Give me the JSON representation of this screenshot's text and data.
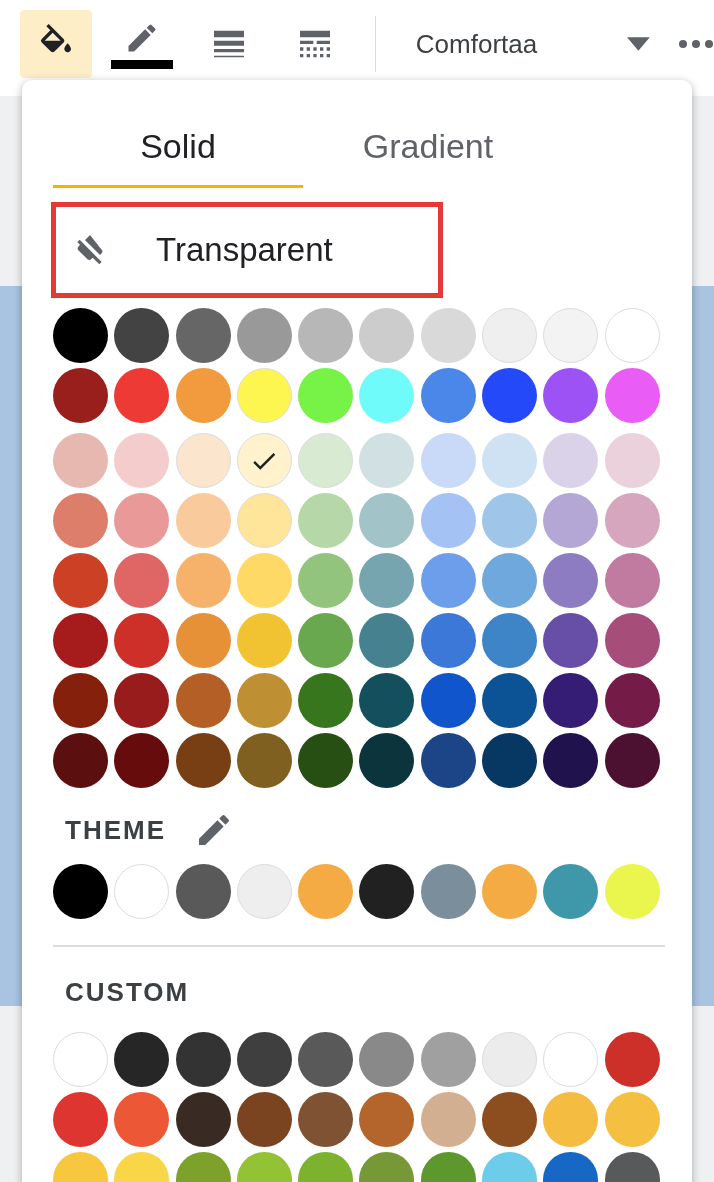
{
  "toolbar": {
    "items": [
      {
        "kind": "fill",
        "selected": true
      },
      {
        "kind": "pencil",
        "selected": false,
        "color": "#000000"
      },
      {
        "kind": "weight",
        "selected": false
      },
      {
        "kind": "dash",
        "selected": false
      }
    ],
    "font": "Comfortaa"
  },
  "popup": {
    "tabs": [
      {
        "label": "Solid",
        "selected": true
      },
      {
        "label": "Gradient",
        "selected": false
      }
    ],
    "transparent": {
      "label": "Transparent"
    },
    "standard": [
      [
        {
          "color": "#000000",
          "selected": false
        },
        {
          "color": "#434343",
          "selected": false
        },
        {
          "color": "#666666",
          "selected": false
        },
        {
          "color": "#999999",
          "selected": false
        },
        {
          "color": "#b7b7b7",
          "selected": false
        },
        {
          "color": "#cccccc",
          "selected": false
        },
        {
          "color": "#d9d9d9",
          "selected": false
        },
        {
          "color": "#efefef",
          "selected": false
        },
        {
          "color": "#f3f3f3",
          "selected": false
        },
        {
          "color": "#ffffff",
          "selected": false
        }
      ],
      [
        {
          "color": "#981f1c",
          "selected": false
        },
        {
          "color": "#ee3a35",
          "selected": false
        },
        {
          "color": "#f29b3e",
          "selected": false
        },
        {
          "color": "#fef650",
          "selected": false
        },
        {
          "color": "#76f346",
          "selected": false
        },
        {
          "color": "#6efbf9",
          "selected": false
        },
        {
          "color": "#4b87e8",
          "selected": false
        },
        {
          "color": "#2449f9",
          "selected": false
        },
        {
          "color": "#9d52f6",
          "selected": false
        },
        {
          "color": "#ea5cf6",
          "selected": false
        }
      ],
      [
        {
          "color": "#e6b8af",
          "selected": false
        },
        {
          "color": "#f4cccc",
          "selected": false
        },
        {
          "color": "#fce5cd",
          "selected": false
        },
        {
          "color": "#fff2cc",
          "selected": true
        },
        {
          "color": "#d9ead3",
          "selected": false
        },
        {
          "color": "#d0e0e3",
          "selected": false
        },
        {
          "color": "#c9daf8",
          "selected": false
        },
        {
          "color": "#cfe2f3",
          "selected": false
        },
        {
          "color": "#d9d2e9",
          "selected": false
        },
        {
          "color": "#ead1dc",
          "selected": false
        }
      ],
      [
        {
          "color": "#dd7e6b",
          "selected": false
        },
        {
          "color": "#ea9999",
          "selected": false
        },
        {
          "color": "#f9cb9c",
          "selected": false
        },
        {
          "color": "#ffe599",
          "selected": false
        },
        {
          "color": "#b6d7a8",
          "selected": false
        },
        {
          "color": "#a2c4c9",
          "selected": false
        },
        {
          "color": "#a4c2f4",
          "selected": false
        },
        {
          "color": "#9fc5e8",
          "selected": false
        },
        {
          "color": "#b4a7d6",
          "selected": false
        },
        {
          "color": "#d5a6bd",
          "selected": false
        }
      ],
      [
        {
          "color": "#cc4125",
          "selected": false
        },
        {
          "color": "#e06666",
          "selected": false
        },
        {
          "color": "#f6b26b",
          "selected": false
        },
        {
          "color": "#ffd966",
          "selected": false
        },
        {
          "color": "#93c47d",
          "selected": false
        },
        {
          "color": "#76a5af",
          "selected": false
        },
        {
          "color": "#6d9eeb",
          "selected": false
        },
        {
          "color": "#6fa8dc",
          "selected": false
        },
        {
          "color": "#8e7cc3",
          "selected": false
        },
        {
          "color": "#c27ba0",
          "selected": false
        }
      ],
      [
        {
          "color": "#a61c1c",
          "selected": false
        },
        {
          "color": "#cc3029",
          "selected": false
        },
        {
          "color": "#e69138",
          "selected": false
        },
        {
          "color": "#f1c232",
          "selected": false
        },
        {
          "color": "#6aa84f",
          "selected": false
        },
        {
          "color": "#45818e",
          "selected": false
        },
        {
          "color": "#3c78d8",
          "selected": false
        },
        {
          "color": "#3d85c6",
          "selected": false
        },
        {
          "color": "#674ea7",
          "selected": false
        },
        {
          "color": "#a64d79",
          "selected": false
        }
      ],
      [
        {
          "color": "#85200c",
          "selected": false
        },
        {
          "color": "#991c1c",
          "selected": false
        },
        {
          "color": "#b45f26",
          "selected": false
        },
        {
          "color": "#bf9033",
          "selected": false
        },
        {
          "color": "#38761d",
          "selected": false
        },
        {
          "color": "#134f5c",
          "selected": false
        },
        {
          "color": "#1155cc",
          "selected": false
        },
        {
          "color": "#0b5394",
          "selected": false
        },
        {
          "color": "#351c75",
          "selected": false
        },
        {
          "color": "#741b47",
          "selected": false
        }
      ],
      [
        {
          "color": "#5b0f0f",
          "selected": false
        },
        {
          "color": "#660c0c",
          "selected": false
        },
        {
          "color": "#783f14",
          "selected": false
        },
        {
          "color": "#7f6020",
          "selected": false
        },
        {
          "color": "#274e13",
          "selected": false
        },
        {
          "color": "#0c343d",
          "selected": false
        },
        {
          "color": "#1c4587",
          "selected": false
        },
        {
          "color": "#073763",
          "selected": false
        },
        {
          "color": "#20124d",
          "selected": false
        },
        {
          "color": "#4c1130",
          "selected": false
        }
      ]
    ],
    "theme": {
      "label": "THEME",
      "swatches": [
        [
          {
            "color": "#000000",
            "selected": false
          },
          {
            "color": "#ffffff",
            "selected": false
          },
          {
            "color": "#595959",
            "selected": false
          },
          {
            "color": "#eeeeee",
            "selected": false
          },
          {
            "color": "#f4ab44",
            "selected": false
          },
          {
            "color": "#212121",
            "selected": false
          },
          {
            "color": "#7a8f9b",
            "selected": false
          },
          {
            "color": "#f4ab44",
            "selected": false
          },
          {
            "color": "#3f98aa",
            "selected": false
          },
          {
            "color": "#eaf54e",
            "selected": false
          }
        ]
      ]
    },
    "custom": {
      "label": "CUSTOM",
      "swatches": [
        [
          {
            "color": "#ffffff",
            "selected": false
          },
          {
            "color": "#262626",
            "selected": false
          },
          {
            "color": "#333333",
            "selected": false
          },
          {
            "color": "#3f3f3f",
            "selected": false
          },
          {
            "color": "#595959",
            "selected": false
          },
          {
            "color": "#898989",
            "selected": false
          },
          {
            "color": "#a0a0a0",
            "selected": false
          },
          {
            "color": "#ececec",
            "selected": false
          },
          {
            "color": "#ffffff",
            "selected": false
          },
          {
            "color": "#cd3029",
            "selected": false
          }
        ],
        [
          {
            "color": "#df3530",
            "selected": false
          },
          {
            "color": "#ec5735",
            "selected": false
          },
          {
            "color": "#3a2a24",
            "selected": false
          },
          {
            "color": "#7a4421",
            "selected": false
          },
          {
            "color": "#7f5233",
            "selected": false
          },
          {
            "color": "#b3652b",
            "selected": false
          },
          {
            "color": "#d3af92",
            "selected": false
          },
          {
            "color": "#8c4d1f",
            "selected": false
          },
          {
            "color": "#f5bc42",
            "selected": false
          },
          {
            "color": "#f5bf42",
            "selected": false
          }
        ],
        [
          {
            "color": "#f8c740",
            "selected": false
          },
          {
            "color": "#f9d647",
            "selected": false
          },
          {
            "color": "#7ea12c",
            "selected": false
          },
          {
            "color": "#93c234",
            "selected": false
          },
          {
            "color": "#7db22f",
            "selected": false
          },
          {
            "color": "#779836",
            "selected": false
          },
          {
            "color": "#5c982e",
            "selected": false
          },
          {
            "color": "#6dcce9",
            "selected": false
          },
          {
            "color": "#1768c4",
            "selected": false
          },
          {
            "color": "#58595b",
            "selected": false
          }
        ]
      ]
    }
  }
}
